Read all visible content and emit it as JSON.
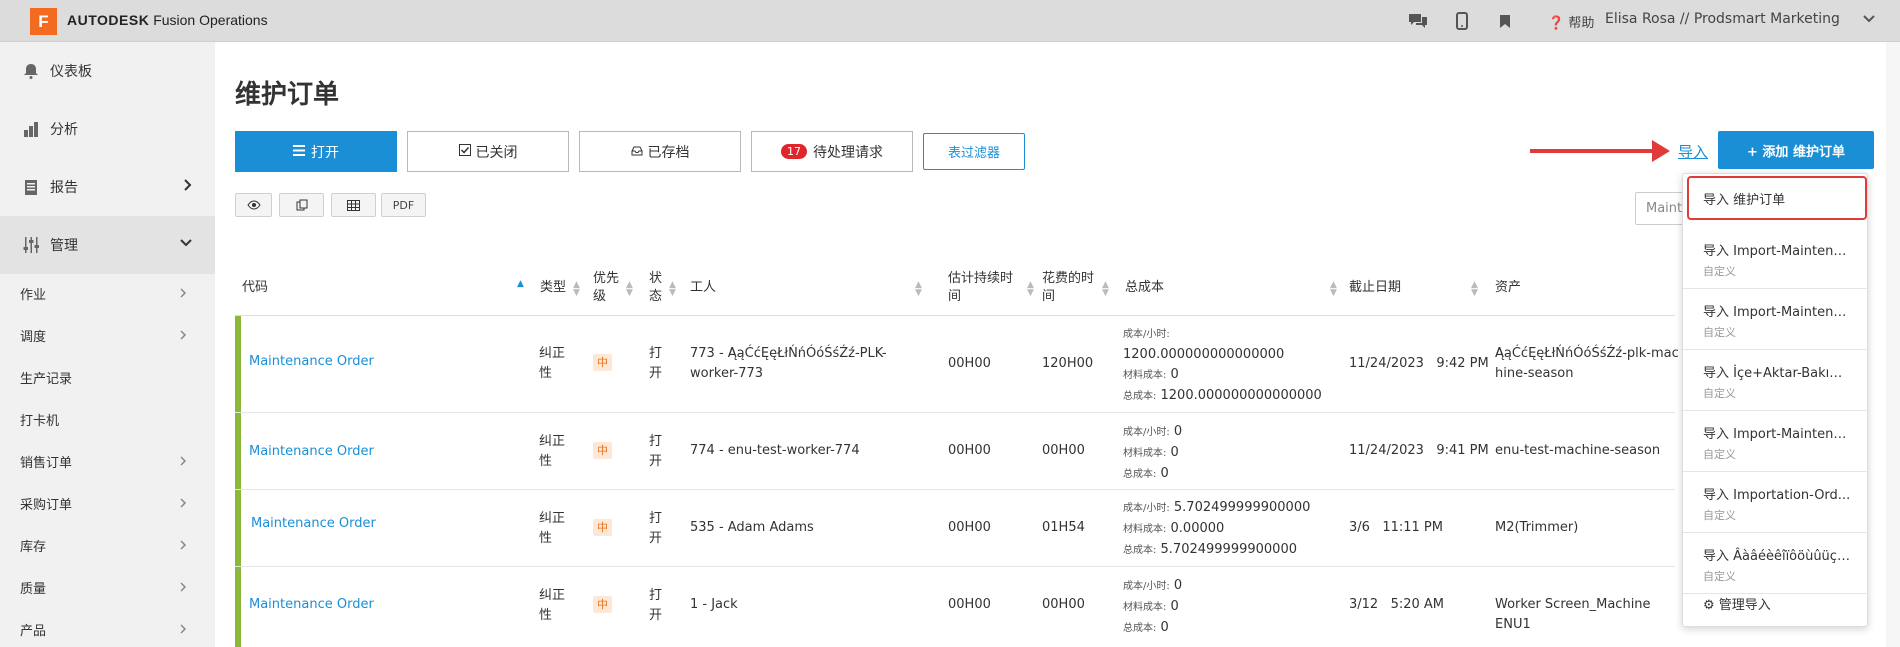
{
  "topbar": {
    "logo_letter": "F",
    "brand_bold": "AUTODESK",
    "brand_rest": " Fusion Operations",
    "help_label": "帮助",
    "user_label": "Elisa Rosa // Prodsmart Marketing",
    "icons": [
      "chat-icon",
      "mobile-icon",
      "bookmark-icon",
      "help-icon"
    ]
  },
  "sidebar": {
    "main": [
      {
        "label": "仪表板",
        "icon": "bell-icon"
      },
      {
        "label": "分析",
        "icon": "bar-chart-icon"
      },
      {
        "label": "报告",
        "icon": "document-icon"
      },
      {
        "label": "管理",
        "icon": "sliders-icon"
      }
    ],
    "sub": [
      "作业",
      "调度",
      "生产记录",
      "打卡机",
      "销售订单",
      "采购订单",
      "库存",
      "质量",
      "产品"
    ]
  },
  "page": {
    "title": "维护订单",
    "tabs": [
      {
        "label": "打开",
        "icon": "list-icon"
      },
      {
        "label": "已关闭",
        "icon": "check-square-icon"
      },
      {
        "label": "已存档",
        "icon": "archive-icon"
      },
      {
        "label": "待处理请求",
        "badge": "17"
      }
    ],
    "filter_label": "表过滤器",
    "tool_buttons": [
      "eye-icon",
      "copy-icon",
      "table-icon",
      "PDF"
    ],
    "import_label": "导入",
    "add_label": "+ 添加 维护订单",
    "search_placeholder": "Maint"
  },
  "table": {
    "headers": {
      "code": "代码",
      "type": "类型",
      "priority": "优先级",
      "status": "状态",
      "worker": "工人",
      "est_duration": "估计持续时间",
      "time_spent": "花费的时间",
      "total_cost": "总成本",
      "due_date": "截止日期",
      "asset": "资产"
    },
    "cost_labels": {
      "hourly": "成本/小时:",
      "material": "材料成本:",
      "total": "总成本:"
    },
    "rows": [
      {
        "code": "Maintenance Order",
        "type": "纠正性",
        "priority": "中",
        "status": "打开",
        "worker": "773 - ĄąĆćĘęŁłŃńÓóŚśŹź-PLK-worker-773",
        "est": "00H00",
        "spent": "120H00",
        "hourly": "1200.000000000000000",
        "material": "0",
        "total": "1200.000000000000000",
        "due": "11/24/2023   9:42 PM",
        "asset": "ĄąĆćĘęŁłŃńÓóŚśŹź-plk-machine-season"
      },
      {
        "code": "Maintenance Order",
        "type": "纠正性",
        "priority": "中",
        "status": "打开",
        "worker": "774 - enu-test-worker-774",
        "est": "00H00",
        "spent": "00H00",
        "hourly": "0",
        "material": "0",
        "total": "0",
        "due": "11/24/2023   9:41 PM",
        "asset": "enu-test-machine-season"
      },
      {
        "code": "Maintenance Order",
        "type": "纠正性",
        "priority": "中",
        "status": "打开",
        "worker": "535 - Adam Adams",
        "est": "00H00",
        "spent": "01H54",
        "hourly": "5.702499999900000",
        "material": "0.00000",
        "total": "5.702499999900000",
        "due": "3/6   11:11 PM",
        "asset": "M2(Trimmer)"
      },
      {
        "code": "Maintenance Order",
        "type": "纠正性",
        "priority": "中",
        "status": "打开",
        "worker": "1 - Jack",
        "est": "00H00",
        "spent": "00H00",
        "hourly": "0",
        "material": "0",
        "total": "0",
        "due": "3/12   5:20 AM",
        "asset": "Worker Screen_Machine ENU1"
      }
    ]
  },
  "import_menu": {
    "first": "导入 维护订单",
    "items": [
      {
        "title": "导入 Import-Maintena...",
        "sub": "自定义"
      },
      {
        "title": "导入 Import-Maintena...",
        "sub": "自定义"
      },
      {
        "title": "导入 İçe+Aktar-Bakım...",
        "sub": "自定义"
      },
      {
        "title": "导入 Import-Maintena...",
        "sub": "自定义"
      },
      {
        "title": "导入 Importation-Ord...",
        "sub": "自定义"
      },
      {
        "title": "导入 Âàâéèêîïôöùûüçœ...",
        "sub": "自定义"
      }
    ],
    "manage_label": "管理导入"
  },
  "colors": {
    "accent": "#1a8fd6",
    "brand": "#f26b21",
    "row_bar": "#8bb73b",
    "highlight": "#e03a3a"
  }
}
